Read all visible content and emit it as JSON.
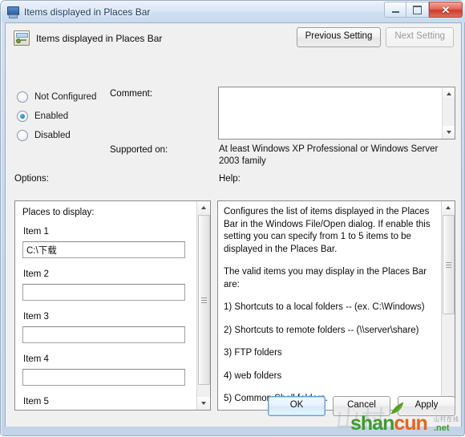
{
  "window": {
    "title": "Items displayed in Places Bar",
    "title_icon": "monitor-icon",
    "buttons": {
      "minimize": "minimize-icon",
      "maximize": "maximize-icon",
      "close": "✕"
    }
  },
  "header": {
    "setting_icon": "policy-setting-icon",
    "setting_title": "Items displayed in Places Bar",
    "previous_setting": "Previous Setting",
    "next_setting": "Next Setting",
    "next_setting_disabled": true
  },
  "state": {
    "options": [
      {
        "label": "Not Configured",
        "selected": false
      },
      {
        "label": "Enabled",
        "selected": true
      },
      {
        "label": "Disabled",
        "selected": false
      }
    ]
  },
  "comment": {
    "label": "Comment:",
    "value": ""
  },
  "supported": {
    "label": "Supported on:",
    "text": "At least Windows XP Professional or Windows Server 2003 family"
  },
  "options_panel": {
    "label": "Options:",
    "places_title": "Places to display:",
    "items": [
      {
        "label": "Item 1",
        "value": "C:\\下载"
      },
      {
        "label": "Item 2",
        "value": ""
      },
      {
        "label": "Item 3",
        "value": ""
      },
      {
        "label": "Item 4",
        "value": ""
      },
      {
        "label": "Item 5",
        "value": ""
      }
    ]
  },
  "help_panel": {
    "label": "Help:",
    "paragraphs": [
      "Configures the list of items displayed in the Places Bar in the Windows File/Open dialog. If enable this setting you can specify from 1 to 5 items to be displayed in the Places Bar.",
      "The valid items you may display in the Places Bar are:",
      "1) Shortcuts to a local folders -- (ex. C:\\Windows)",
      "2) Shortcuts to remote folders -- (\\\\server\\share)",
      "3) FTP folders",
      "4) web folders",
      "5) Common Shell folders."
    ]
  },
  "footer": {
    "ok": "OK",
    "cancel": "Cancel",
    "apply": "Apply"
  },
  "watermark": {
    "brand_first": "shan",
    "brand_second": "cun",
    "suffix": ".net",
    "subtext": "山村在线",
    "ghost": "山村"
  },
  "colors": {
    "accent": "#2b79c2",
    "close_button": "#cf3c2c",
    "brand_green": "#3f9a2f",
    "brand_orange": "#e8631a",
    "window_chrome": "#c9daee",
    "client_bg": "#f0f0f0"
  }
}
